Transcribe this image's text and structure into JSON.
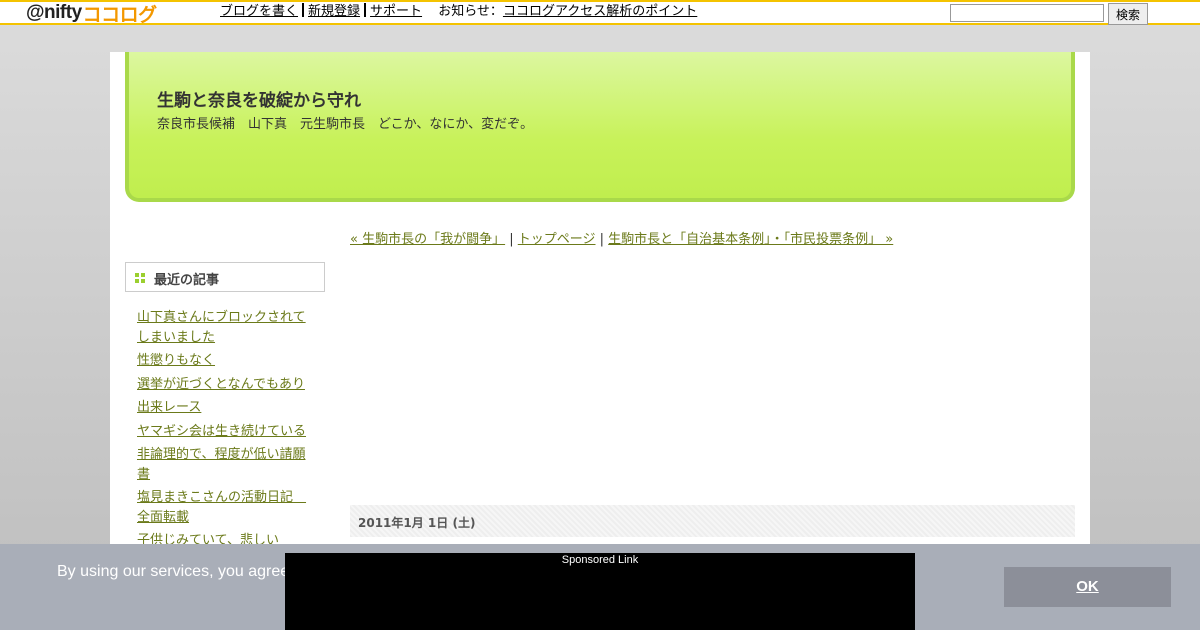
{
  "topbar": {
    "logo_at": "@nifty",
    "logo_brand": "ココログ",
    "nav": [
      "ブログを書く",
      "新規登録",
      "サポート"
    ],
    "notice_label": "お知らせ：",
    "notice_link": "ココログアクセス解析のポイント",
    "search_value": "",
    "search_button": "検索"
  },
  "blog": {
    "title": "生駒と奈良を破綻から守れ",
    "description": "奈良市長候補　山下真　元生駒市長　どこか、なにか、変だぞ。"
  },
  "pager": {
    "prev": "« 生駒市長の「我が闘争」",
    "sep1": " | ",
    "top": "トップページ",
    "sep2": " | ",
    "next": "生駒市長と「自治基本条例」・「市民投票条例」 »"
  },
  "sidebar": {
    "heading": "最近の記事",
    "recent_articles": [
      "山下真さんにブロックされてしまいました",
      "性懲りもなく",
      "選挙が近づくとなんでもあり",
      "出来レース",
      "ヤマギシ会は生き続けている",
      "非論理的で、程度が低い請願書",
      "塩見まきこさんの活動日記　全面転載",
      "子供じみていて、悲しい"
    ]
  },
  "entry": {
    "date": "2011年1月 1日 (土)"
  },
  "cookie": {
    "text": "By using our services, you agree to our use of cookies as described in the privacy notice on our",
    "ok": "OK"
  },
  "ad": {
    "label": "Sponsored Link"
  },
  "colors": {
    "link": "#6b7a1a",
    "banner_green": "#c8f25a",
    "topbar_border": "#f4c300",
    "cookie_bg": "#a9aeb8"
  }
}
